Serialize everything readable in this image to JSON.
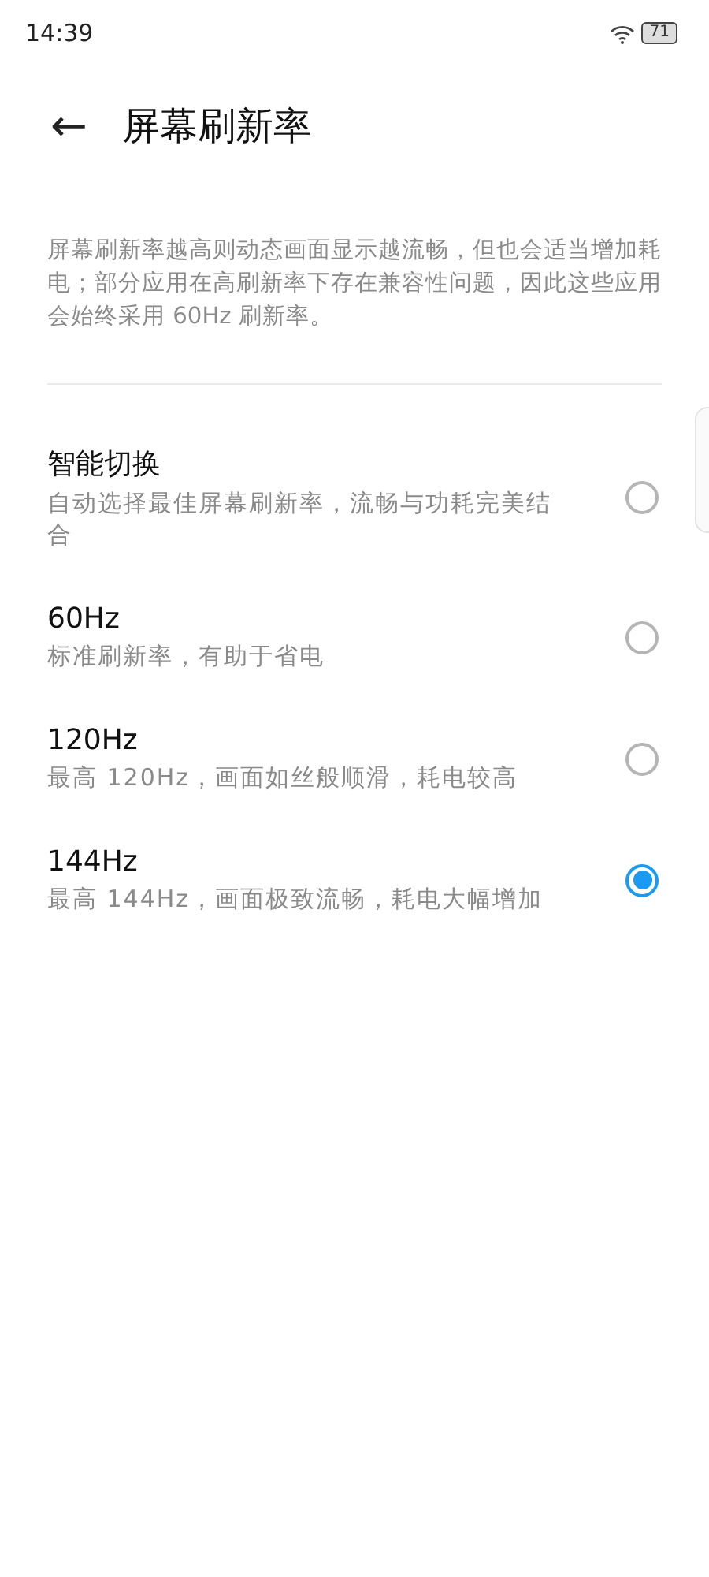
{
  "status_bar": {
    "time": "14:39",
    "battery": "71"
  },
  "header": {
    "back_icon": "←",
    "title": "屏幕刷新率"
  },
  "description": "屏幕刷新率越高则动态画面显示越流畅，但也会适当增加耗电；部分应用在高刷新率下存在兼容性问题，因此这些应用会始终采用 60Hz 刷新率。",
  "options": [
    {
      "title": "智能切换",
      "subtitle": "自动选择最佳屏幕刷新率，流畅与功耗完美结合",
      "selected": false
    },
    {
      "title": "60Hz",
      "subtitle": "标准刷新率，有助于省电",
      "selected": false
    },
    {
      "title": "120Hz",
      "subtitle": "最高 120Hz，画面如丝般顺滑，耗电较高",
      "selected": false
    },
    {
      "title": "144Hz",
      "subtitle": "最高 144Hz，画面极致流畅，耗电大幅增加",
      "selected": true
    }
  ]
}
